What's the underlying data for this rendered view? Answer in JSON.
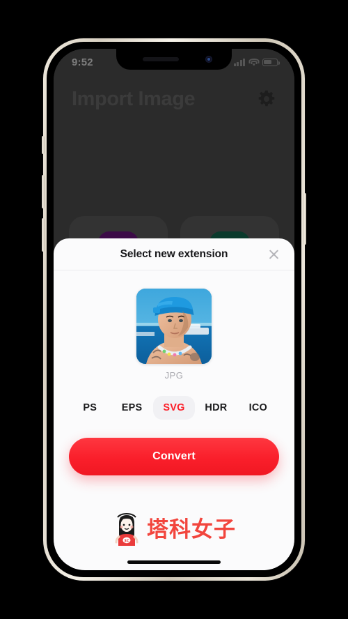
{
  "device": {
    "frame_color": "#e8e1d4",
    "screen_bg": "#2b2b2b"
  },
  "status_bar": {
    "time": "9:52",
    "signal_icon": "cellular-signal-icon",
    "wifi_icon": "wifi-icon",
    "battery_icon": "battery-icon"
  },
  "app_background": {
    "title": "Import Image",
    "settings_icon": "gear-icon",
    "cards": [
      {
        "icon": "photo-library-icon",
        "icon_color": "#3c0b47"
      },
      {
        "icon": "link-chain-icon",
        "icon_color": "#0a3a2c"
      }
    ]
  },
  "modal": {
    "title": "Select new extension",
    "close_icon": "close-icon",
    "preview": {
      "thumbnail_alt": "portrait-photo-person-blue-cap-beach",
      "format_label": "JPG"
    },
    "extensions": [
      {
        "label": "PS",
        "selected": false
      },
      {
        "label": "EPS",
        "selected": false
      },
      {
        "label": "SVG",
        "selected": true
      },
      {
        "label": "HDR",
        "selected": false
      },
      {
        "label": "ICO",
        "selected": false
      }
    ],
    "selected_extension": "SVG",
    "accent_color": "#fc1f29",
    "primary_button": "Convert"
  },
  "watermark": {
    "text": "塔科女子",
    "color": "#f2453d",
    "mascot_icon": "girl-mascot-icon",
    "mascot_shirt_text": "3C"
  },
  "home_indicator": "home-indicator"
}
